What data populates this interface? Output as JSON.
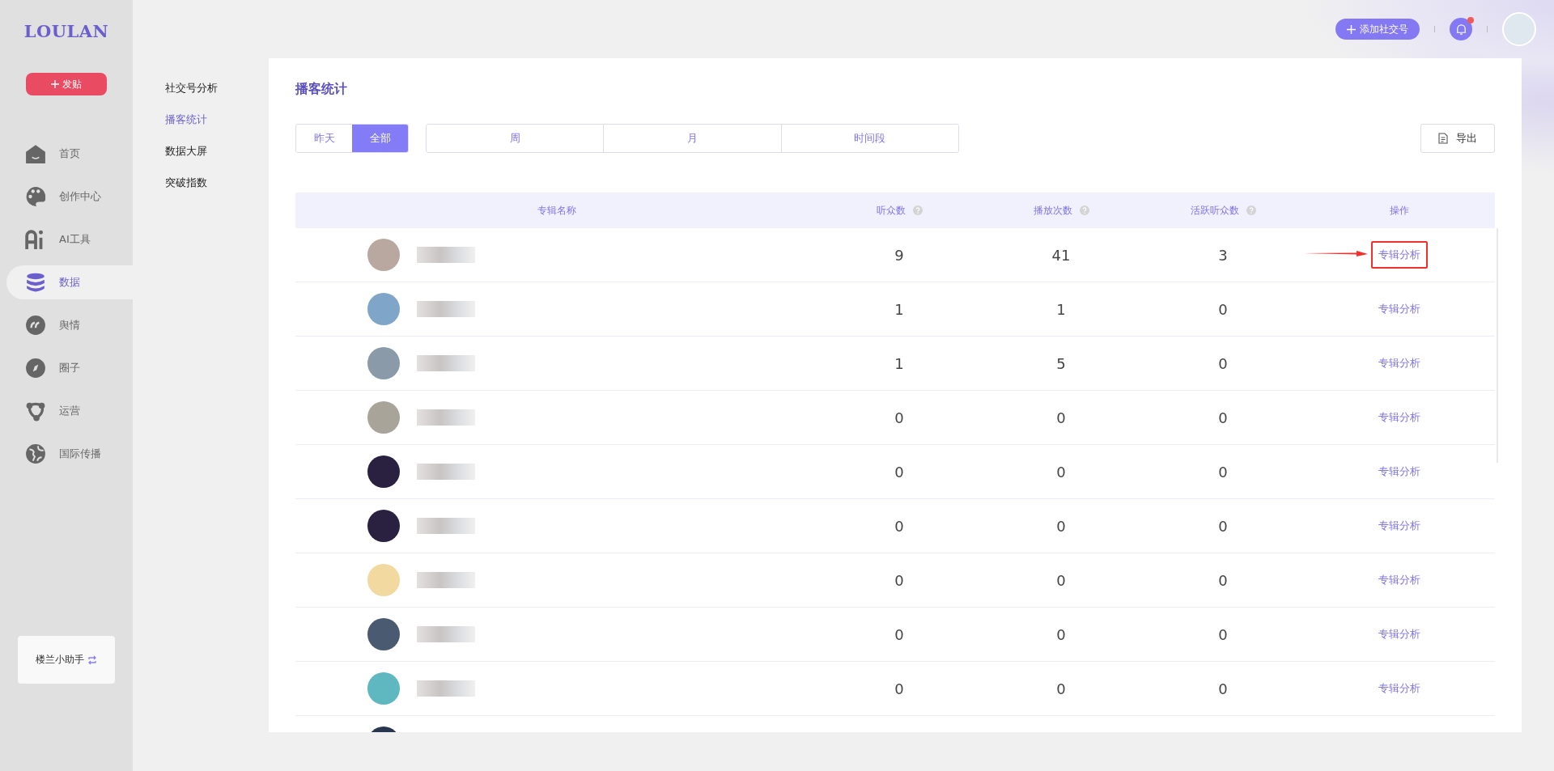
{
  "logo": "LOULAN",
  "post_button": "发贴",
  "nav": [
    {
      "label": "首页",
      "selected": false
    },
    {
      "label": "创作中心",
      "selected": false
    },
    {
      "label": "AI工具",
      "selected": false
    },
    {
      "label": "数据",
      "selected": true
    },
    {
      "label": "舆情",
      "selected": false
    },
    {
      "label": "圈子",
      "selected": false
    },
    {
      "label": "运营",
      "selected": false
    },
    {
      "label": "国际传播",
      "selected": false
    }
  ],
  "assistant": "楼兰小助手",
  "submenu": [
    {
      "label": "社交号分析",
      "selected": false
    },
    {
      "label": "播客统计",
      "selected": true
    },
    {
      "label": "数据大屏",
      "selected": false
    },
    {
      "label": "突破指数",
      "selected": false
    }
  ],
  "topbar": {
    "add_button": "添加社交号",
    "notification_dot": true
  },
  "page_title": "播客统计",
  "range_tabs": [
    {
      "label": "昨天",
      "selected": false
    },
    {
      "label": "全部",
      "selected": true
    }
  ],
  "period_tabs": [
    {
      "label": "周",
      "selected": false
    },
    {
      "label": "月",
      "selected": false
    },
    {
      "label": "时间段",
      "selected": false
    }
  ],
  "export_button": "导出",
  "table": {
    "columns": [
      {
        "label": "专辑名称",
        "help": false
      },
      {
        "label": "听众数",
        "help": true
      },
      {
        "label": "播放次数",
        "help": true
      },
      {
        "label": "活跃听众数",
        "help": true
      },
      {
        "label": "操作",
        "help": false
      }
    ],
    "rows": [
      {
        "listeners": "9",
        "plays": "41",
        "active": "3",
        "action": "专辑分析",
        "highlighted": true
      },
      {
        "listeners": "1",
        "plays": "1",
        "active": "0",
        "action": "专辑分析",
        "highlighted": false
      },
      {
        "listeners": "1",
        "plays": "5",
        "active": "0",
        "action": "专辑分析",
        "highlighted": false
      },
      {
        "listeners": "0",
        "plays": "0",
        "active": "0",
        "action": "专辑分析",
        "highlighted": false
      },
      {
        "listeners": "0",
        "plays": "0",
        "active": "0",
        "action": "专辑分析",
        "highlighted": false
      },
      {
        "listeners": "0",
        "plays": "0",
        "active": "0",
        "action": "专辑分析",
        "highlighted": false
      },
      {
        "listeners": "0",
        "plays": "0",
        "active": "0",
        "action": "专辑分析",
        "highlighted": false
      },
      {
        "listeners": "0",
        "plays": "0",
        "active": "0",
        "action": "专辑分析",
        "highlighted": false
      },
      {
        "listeners": "0",
        "plays": "0",
        "active": "0",
        "action": "专辑分析",
        "highlighted": false
      }
    ]
  }
}
